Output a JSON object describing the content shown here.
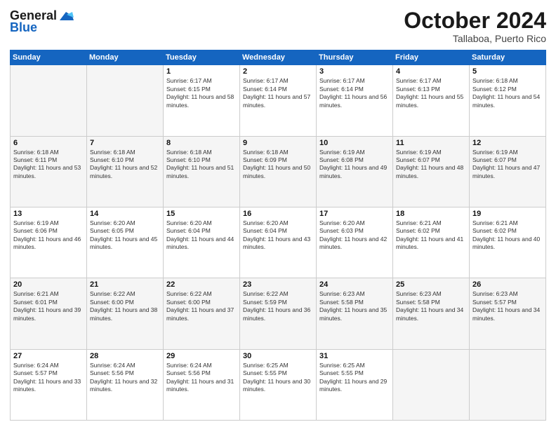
{
  "logo": {
    "line1": "General",
    "line2": "Blue"
  },
  "header": {
    "month": "October 2024",
    "location": "Tallaboa, Puerto Rico"
  },
  "days_of_week": [
    "Sunday",
    "Monday",
    "Tuesday",
    "Wednesday",
    "Thursday",
    "Friday",
    "Saturday"
  ],
  "weeks": [
    [
      {
        "day": "",
        "info": ""
      },
      {
        "day": "",
        "info": ""
      },
      {
        "day": "1",
        "info": "Sunrise: 6:17 AM\nSunset: 6:15 PM\nDaylight: 11 hours and 58 minutes."
      },
      {
        "day": "2",
        "info": "Sunrise: 6:17 AM\nSunset: 6:14 PM\nDaylight: 11 hours and 57 minutes."
      },
      {
        "day": "3",
        "info": "Sunrise: 6:17 AM\nSunset: 6:14 PM\nDaylight: 11 hours and 56 minutes."
      },
      {
        "day": "4",
        "info": "Sunrise: 6:17 AM\nSunset: 6:13 PM\nDaylight: 11 hours and 55 minutes."
      },
      {
        "day": "5",
        "info": "Sunrise: 6:18 AM\nSunset: 6:12 PM\nDaylight: 11 hours and 54 minutes."
      }
    ],
    [
      {
        "day": "6",
        "info": "Sunrise: 6:18 AM\nSunset: 6:11 PM\nDaylight: 11 hours and 53 minutes."
      },
      {
        "day": "7",
        "info": "Sunrise: 6:18 AM\nSunset: 6:10 PM\nDaylight: 11 hours and 52 minutes."
      },
      {
        "day": "8",
        "info": "Sunrise: 6:18 AM\nSunset: 6:10 PM\nDaylight: 11 hours and 51 minutes."
      },
      {
        "day": "9",
        "info": "Sunrise: 6:18 AM\nSunset: 6:09 PM\nDaylight: 11 hours and 50 minutes."
      },
      {
        "day": "10",
        "info": "Sunrise: 6:19 AM\nSunset: 6:08 PM\nDaylight: 11 hours and 49 minutes."
      },
      {
        "day": "11",
        "info": "Sunrise: 6:19 AM\nSunset: 6:07 PM\nDaylight: 11 hours and 48 minutes."
      },
      {
        "day": "12",
        "info": "Sunrise: 6:19 AM\nSunset: 6:07 PM\nDaylight: 11 hours and 47 minutes."
      }
    ],
    [
      {
        "day": "13",
        "info": "Sunrise: 6:19 AM\nSunset: 6:06 PM\nDaylight: 11 hours and 46 minutes."
      },
      {
        "day": "14",
        "info": "Sunrise: 6:20 AM\nSunset: 6:05 PM\nDaylight: 11 hours and 45 minutes."
      },
      {
        "day": "15",
        "info": "Sunrise: 6:20 AM\nSunset: 6:04 PM\nDaylight: 11 hours and 44 minutes."
      },
      {
        "day": "16",
        "info": "Sunrise: 6:20 AM\nSunset: 6:04 PM\nDaylight: 11 hours and 43 minutes."
      },
      {
        "day": "17",
        "info": "Sunrise: 6:20 AM\nSunset: 6:03 PM\nDaylight: 11 hours and 42 minutes."
      },
      {
        "day": "18",
        "info": "Sunrise: 6:21 AM\nSunset: 6:02 PM\nDaylight: 11 hours and 41 minutes."
      },
      {
        "day": "19",
        "info": "Sunrise: 6:21 AM\nSunset: 6:02 PM\nDaylight: 11 hours and 40 minutes."
      }
    ],
    [
      {
        "day": "20",
        "info": "Sunrise: 6:21 AM\nSunset: 6:01 PM\nDaylight: 11 hours and 39 minutes."
      },
      {
        "day": "21",
        "info": "Sunrise: 6:22 AM\nSunset: 6:00 PM\nDaylight: 11 hours and 38 minutes."
      },
      {
        "day": "22",
        "info": "Sunrise: 6:22 AM\nSunset: 6:00 PM\nDaylight: 11 hours and 37 minutes."
      },
      {
        "day": "23",
        "info": "Sunrise: 6:22 AM\nSunset: 5:59 PM\nDaylight: 11 hours and 36 minutes."
      },
      {
        "day": "24",
        "info": "Sunrise: 6:23 AM\nSunset: 5:58 PM\nDaylight: 11 hours and 35 minutes."
      },
      {
        "day": "25",
        "info": "Sunrise: 6:23 AM\nSunset: 5:58 PM\nDaylight: 11 hours and 34 minutes."
      },
      {
        "day": "26",
        "info": "Sunrise: 6:23 AM\nSunset: 5:57 PM\nDaylight: 11 hours and 34 minutes."
      }
    ],
    [
      {
        "day": "27",
        "info": "Sunrise: 6:24 AM\nSunset: 5:57 PM\nDaylight: 11 hours and 33 minutes."
      },
      {
        "day": "28",
        "info": "Sunrise: 6:24 AM\nSunset: 5:56 PM\nDaylight: 11 hours and 32 minutes."
      },
      {
        "day": "29",
        "info": "Sunrise: 6:24 AM\nSunset: 5:56 PM\nDaylight: 11 hours and 31 minutes."
      },
      {
        "day": "30",
        "info": "Sunrise: 6:25 AM\nSunset: 5:55 PM\nDaylight: 11 hours and 30 minutes."
      },
      {
        "day": "31",
        "info": "Sunrise: 6:25 AM\nSunset: 5:55 PM\nDaylight: 11 hours and 29 minutes."
      },
      {
        "day": "",
        "info": ""
      },
      {
        "day": "",
        "info": ""
      }
    ]
  ]
}
